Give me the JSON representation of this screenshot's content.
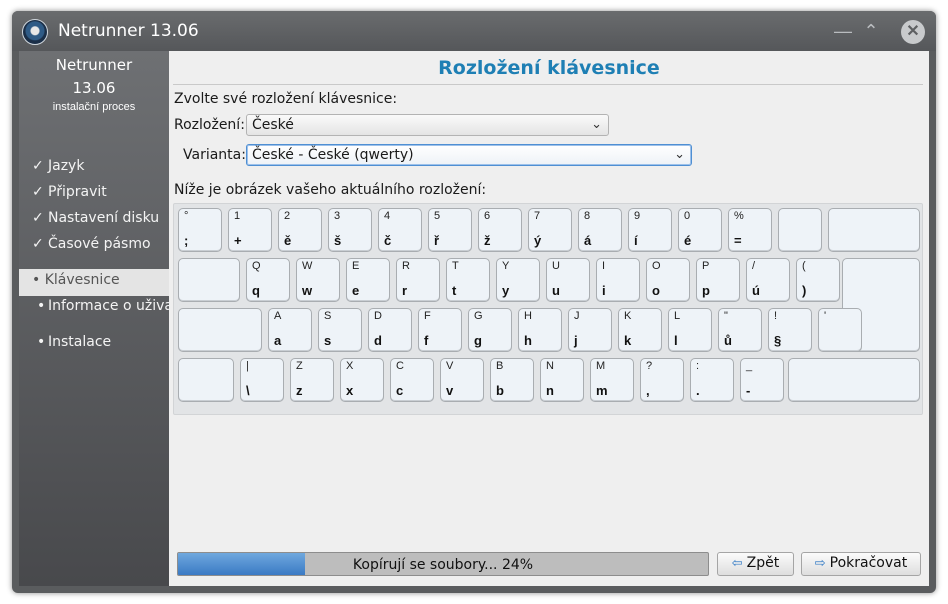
{
  "window": {
    "title": "Netrunner 13.06",
    "logo_icon": "netrunner-logo-icon"
  },
  "sidebar": {
    "title": "Netrunner",
    "version": "13.06",
    "subtitle": "instalační proces",
    "done_items": [
      {
        "mark": "✓",
        "label": "Jazyk"
      },
      {
        "mark": "✓",
        "label": "Připravit"
      },
      {
        "mark": "✓",
        "label": "Nastavení disku"
      },
      {
        "mark": "✓",
        "label": "Časové pásmo"
      }
    ],
    "active_item": "• Klávesnice",
    "pending_items": [
      {
        "mark": "•",
        "label": "Informace o uživateli"
      },
      {
        "mark": "•",
        "label": "Instalace"
      }
    ]
  },
  "main": {
    "title": "Rozložení klávesnice",
    "prompt": "Zvolte své rozložení klávesnice:",
    "layout_label": "Rozložení:",
    "layout_value": "České",
    "variant_label": "Varianta:",
    "variant_value": "České - České (qwerty)",
    "image_caption": "Níže je obrázek vašeho aktuálního rozložení:"
  },
  "keyboard": {
    "row1": [
      {
        "u": "°",
        "l": ";"
      },
      {
        "u": "1",
        "l": "+"
      },
      {
        "u": "2",
        "l": "ě"
      },
      {
        "u": "3",
        "l": "š"
      },
      {
        "u": "4",
        "l": "č"
      },
      {
        "u": "5",
        "l": "ř"
      },
      {
        "u": "6",
        "l": "ž"
      },
      {
        "u": "7",
        "l": "ý"
      },
      {
        "u": "8",
        "l": "á"
      },
      {
        "u": "9",
        "l": "í"
      },
      {
        "u": "0",
        "l": "é"
      },
      {
        "u": "%",
        "l": "="
      }
    ],
    "row2": [
      {
        "u": "Q",
        "l": "q"
      },
      {
        "u": "W",
        "l": "w"
      },
      {
        "u": "E",
        "l": "e"
      },
      {
        "u": "R",
        "l": "r"
      },
      {
        "u": "T",
        "l": "t"
      },
      {
        "u": "Y",
        "l": "y"
      },
      {
        "u": "U",
        "l": "u"
      },
      {
        "u": "I",
        "l": "i"
      },
      {
        "u": "O",
        "l": "o"
      },
      {
        "u": "P",
        "l": "p"
      },
      {
        "u": "/",
        "l": "ú"
      },
      {
        "u": "(",
        "l": ")"
      }
    ],
    "row3": [
      {
        "u": "A",
        "l": "a"
      },
      {
        "u": "S",
        "l": "s"
      },
      {
        "u": "D",
        "l": "d"
      },
      {
        "u": "F",
        "l": "f"
      },
      {
        "u": "G",
        "l": "g"
      },
      {
        "u": "H",
        "l": "h"
      },
      {
        "u": "J",
        "l": "j"
      },
      {
        "u": "K",
        "l": "k"
      },
      {
        "u": "L",
        "l": "l"
      },
      {
        "u": "\"",
        "l": "ů"
      },
      {
        "u": "!",
        "l": "§"
      },
      {
        "u": "'",
        "l": ""
      }
    ],
    "row4": [
      {
        "u": "|",
        "l": "\\"
      },
      {
        "u": "Z",
        "l": "z"
      },
      {
        "u": "X",
        "l": "x"
      },
      {
        "u": "C",
        "l": "c"
      },
      {
        "u": "V",
        "l": "v"
      },
      {
        "u": "B",
        "l": "b"
      },
      {
        "u": "N",
        "l": "n"
      },
      {
        "u": "M",
        "l": "m"
      },
      {
        "u": "?",
        "l": ","
      },
      {
        "u": ":",
        "l": "."
      },
      {
        "u": "_",
        "l": "-"
      }
    ]
  },
  "footer": {
    "progress_text": "Kopírují se soubory... 24%",
    "progress_value": 0.24,
    "back_label": "Zpět",
    "next_label": "Pokračovat",
    "accent_color": "#3a7ac4"
  }
}
